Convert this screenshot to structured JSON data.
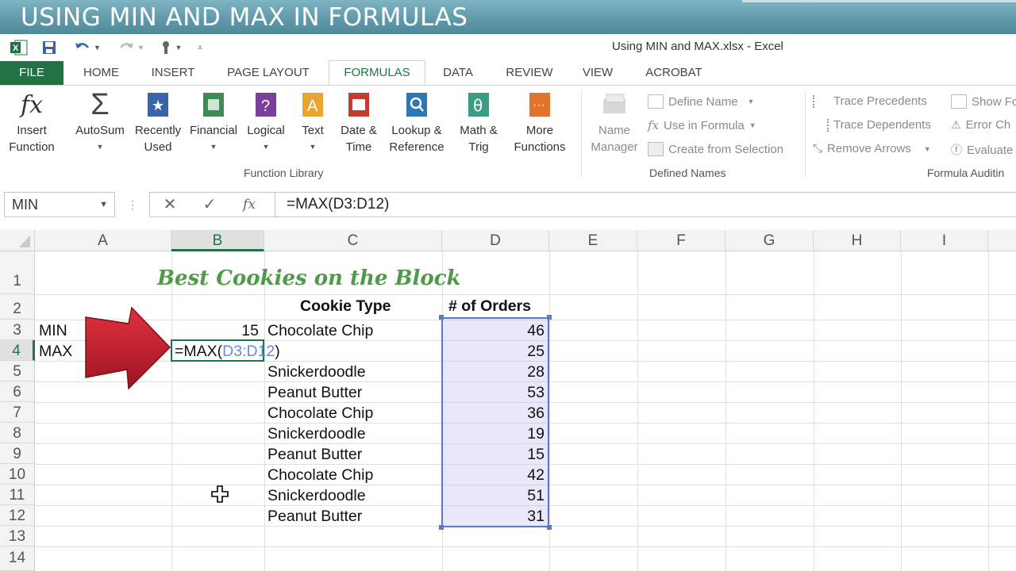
{
  "banner": {
    "title": "USING MIN AND MAX IN FORMULAS"
  },
  "window": {
    "title": "Using MIN and MAX.xlsx - Excel"
  },
  "tabs": [
    "FILE",
    "HOME",
    "INSERT",
    "PAGE LAYOUT",
    "FORMULAS",
    "DATA",
    "REVIEW",
    "VIEW",
    "ACROBAT"
  ],
  "ribbon": {
    "function_library": {
      "label": "Function Library",
      "buttons": [
        {
          "label": "Insert\nFunction"
        },
        {
          "label": "AutoSum"
        },
        {
          "label": "Recently\nUsed"
        },
        {
          "label": "Financial"
        },
        {
          "label": "Logical"
        },
        {
          "label": "Text"
        },
        {
          "label": "Date &\nTime"
        },
        {
          "label": "Lookup &\nReference"
        },
        {
          "label": "Math &\nTrig"
        },
        {
          "label": "More\nFunctions"
        }
      ]
    },
    "defined_names": {
      "label": "Defined Names",
      "name_manager": "Name\nManager",
      "define_name": "Define Name",
      "use_in_formula": "Use in Formula",
      "create_from_selection": "Create from Selection"
    },
    "formula_auditing": {
      "label": "Formula Auditin",
      "trace_precedents": "Trace Precedents",
      "trace_dependents": "Trace Dependents",
      "remove_arrows": "Remove Arrows",
      "show_formulas": "Show Fo",
      "error_checking": "Error Ch",
      "evaluate": "Evaluate"
    }
  },
  "formula_bar": {
    "name_box": "MIN",
    "formula": "=MAX(D3:D12)"
  },
  "sheet": {
    "columns": [
      "A",
      "B",
      "C",
      "D",
      "E",
      "F",
      "G",
      "H",
      "I"
    ],
    "rows": [
      "1",
      "2",
      "3",
      "4",
      "5",
      "6",
      "7",
      "8",
      "9",
      "10",
      "11",
      "12",
      "13",
      "14"
    ],
    "title": "Best Cookies on the Block",
    "header_cookie_type": "Cookie Type",
    "header_orders": "# of Orders",
    "a3": "MIN",
    "a4": "MAX",
    "b3": "15",
    "b4_prefix": "=MAX(",
    "b4_ref": "D3:D12",
    "b4_suffix": ")",
    "cookie_types": [
      "Chocolate Chip",
      "",
      "Snickerdoodle",
      "Peanut Butter",
      "Chocolate Chip",
      "Snickerdoodle",
      "Peanut Butter",
      "Chocolate Chip",
      "Snickerdoodle",
      "Peanut Butter"
    ],
    "orders": [
      "46",
      "25",
      "28",
      "53",
      "36",
      "19",
      "15",
      "42",
      "51",
      "31"
    ]
  },
  "colors": {
    "excel_green": "#217346",
    "title_green": "#4f9a48",
    "arrow_red": "#c8202e",
    "range_blue": "#5b78c9"
  }
}
